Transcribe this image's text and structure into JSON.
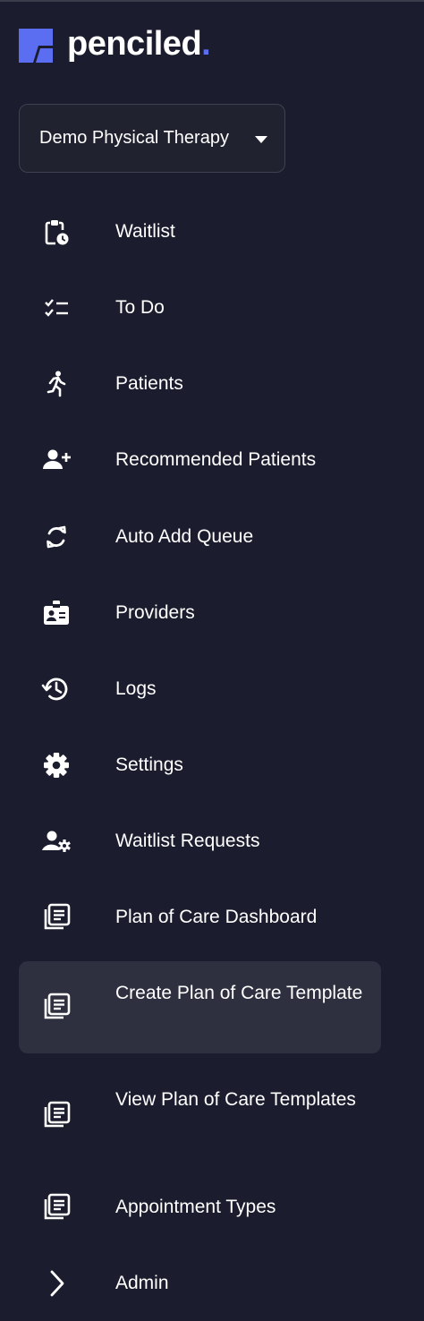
{
  "brand": {
    "name": "penciled",
    "dot": ".",
    "accent_color": "#5b6df0"
  },
  "practice_selector": {
    "selected": "Demo Physical Therapy"
  },
  "nav": {
    "items": [
      {
        "label": "Waitlist",
        "icon": "clipboard-clock-icon"
      },
      {
        "label": "To Do",
        "icon": "checklist-icon"
      },
      {
        "label": "Patients",
        "icon": "running-person-icon"
      },
      {
        "label": "Recommended Patients",
        "icon": "user-plus-icon"
      },
      {
        "label": "Auto Add Queue",
        "icon": "sync-icon"
      },
      {
        "label": "Providers",
        "icon": "id-badge-icon"
      },
      {
        "label": "Logs",
        "icon": "history-icon"
      },
      {
        "label": "Settings",
        "icon": "gear-icon"
      },
      {
        "label": "Waitlist Requests",
        "icon": "user-gear-icon"
      },
      {
        "label": "Plan of Care Dashboard",
        "icon": "document-list-icon"
      },
      {
        "label": "Create Plan of Care Template",
        "icon": "document-list-icon",
        "active": true
      },
      {
        "label": "View Plan of Care Templates",
        "icon": "document-list-icon"
      },
      {
        "label": "Appointment Types",
        "icon": "document-list-icon"
      },
      {
        "label": "Admin",
        "icon": "chevron-right-icon"
      }
    ]
  }
}
